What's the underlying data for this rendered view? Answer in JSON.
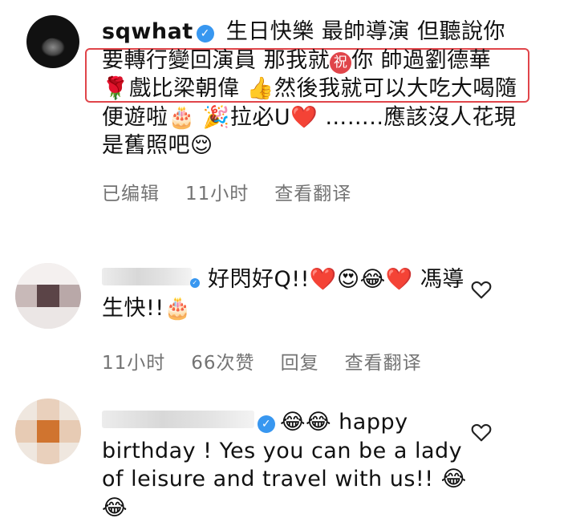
{
  "comment1": {
    "username": "sqwhat",
    "text_before": "生日快樂 最帥導演 但聽說你要轉行變回演員 那我就",
    "badge": "祝",
    "text_after": "你 帥過劉德華 🌹戲比梁朝偉 👍然後我就可以大吃大喝隨便遊啦🎂 🎉拉必U❤️ ……..應該沒人花現是舊照吧😌",
    "edited": "已编辑",
    "time": "11小时",
    "translate": "查看翻译"
  },
  "comment2": {
    "text": "好閃好Q!!❤️😍😂❤️ 馮導生快!!🎂",
    "time": "11小时",
    "likes": "66次赞",
    "reply": "回复",
    "translate": "查看翻译"
  },
  "comment3": {
    "text": "😂😂 happy birthday ! Yes you can be a lady of leisure and travel with us!! 😂😂"
  },
  "colors": {
    "verified": "#3897f0",
    "highlight": "#e0454a",
    "meta": "#737373"
  },
  "icons": [
    "verified-badge-icon",
    "heart-icon"
  ]
}
